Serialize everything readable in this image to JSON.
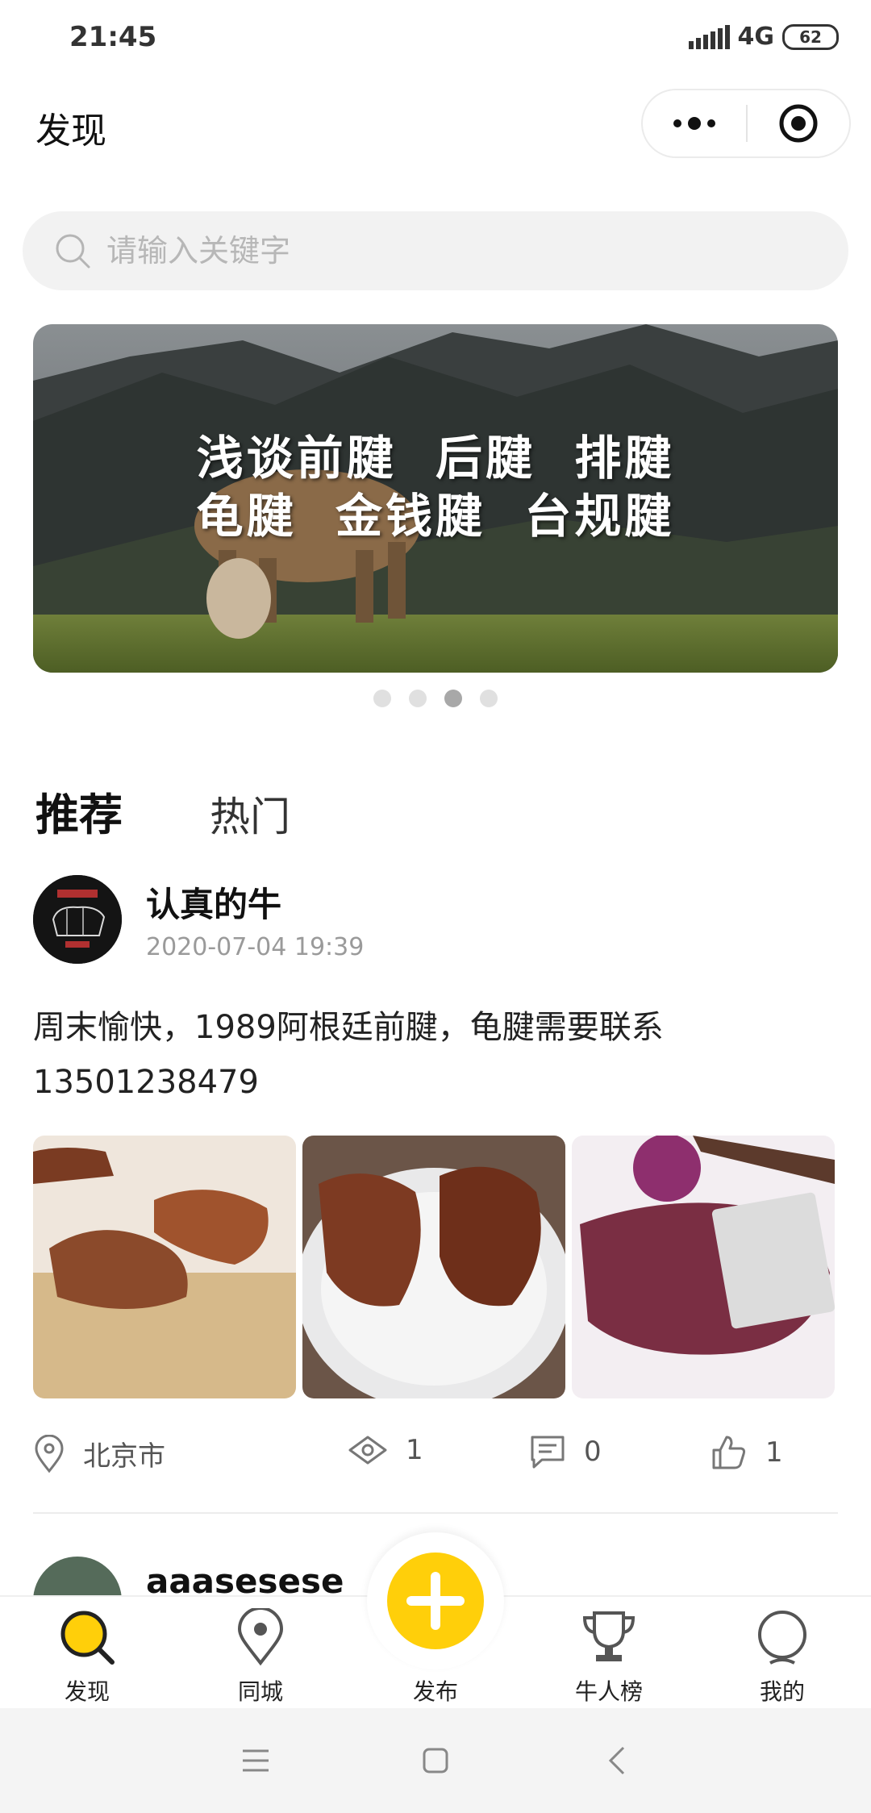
{
  "status_bar": {
    "time": "21:45",
    "network": "4G",
    "battery": "62"
  },
  "header": {
    "title": "发现"
  },
  "search": {
    "placeholder": "请输入关键字"
  },
  "banner": {
    "line1": "浅谈前腱  后腱  排腱",
    "line2": "龟腱  金钱腱  台规腱",
    "page_count": 4,
    "active_index": 2
  },
  "tabs": [
    {
      "label": "推荐",
      "active": true
    },
    {
      "label": "热门",
      "active": false
    }
  ],
  "post": {
    "author": "认真的牛",
    "time": "2020-07-04 19:39",
    "text_line1": "周末愉快，1989阿根廷前腱，龟腱需要联系",
    "text_line2": "13501238479",
    "location": "北京市",
    "views": "1",
    "comments": "0",
    "likes": "1"
  },
  "next_post": {
    "author": "aaasesese"
  },
  "tabbar": {
    "discover": "发现",
    "nearby": "同城",
    "publish": "发布",
    "ranking": "牛人榜",
    "mine": "我的"
  },
  "colors": {
    "accent": "#ffcf0a",
    "tab_underline": "#ffd21e"
  }
}
